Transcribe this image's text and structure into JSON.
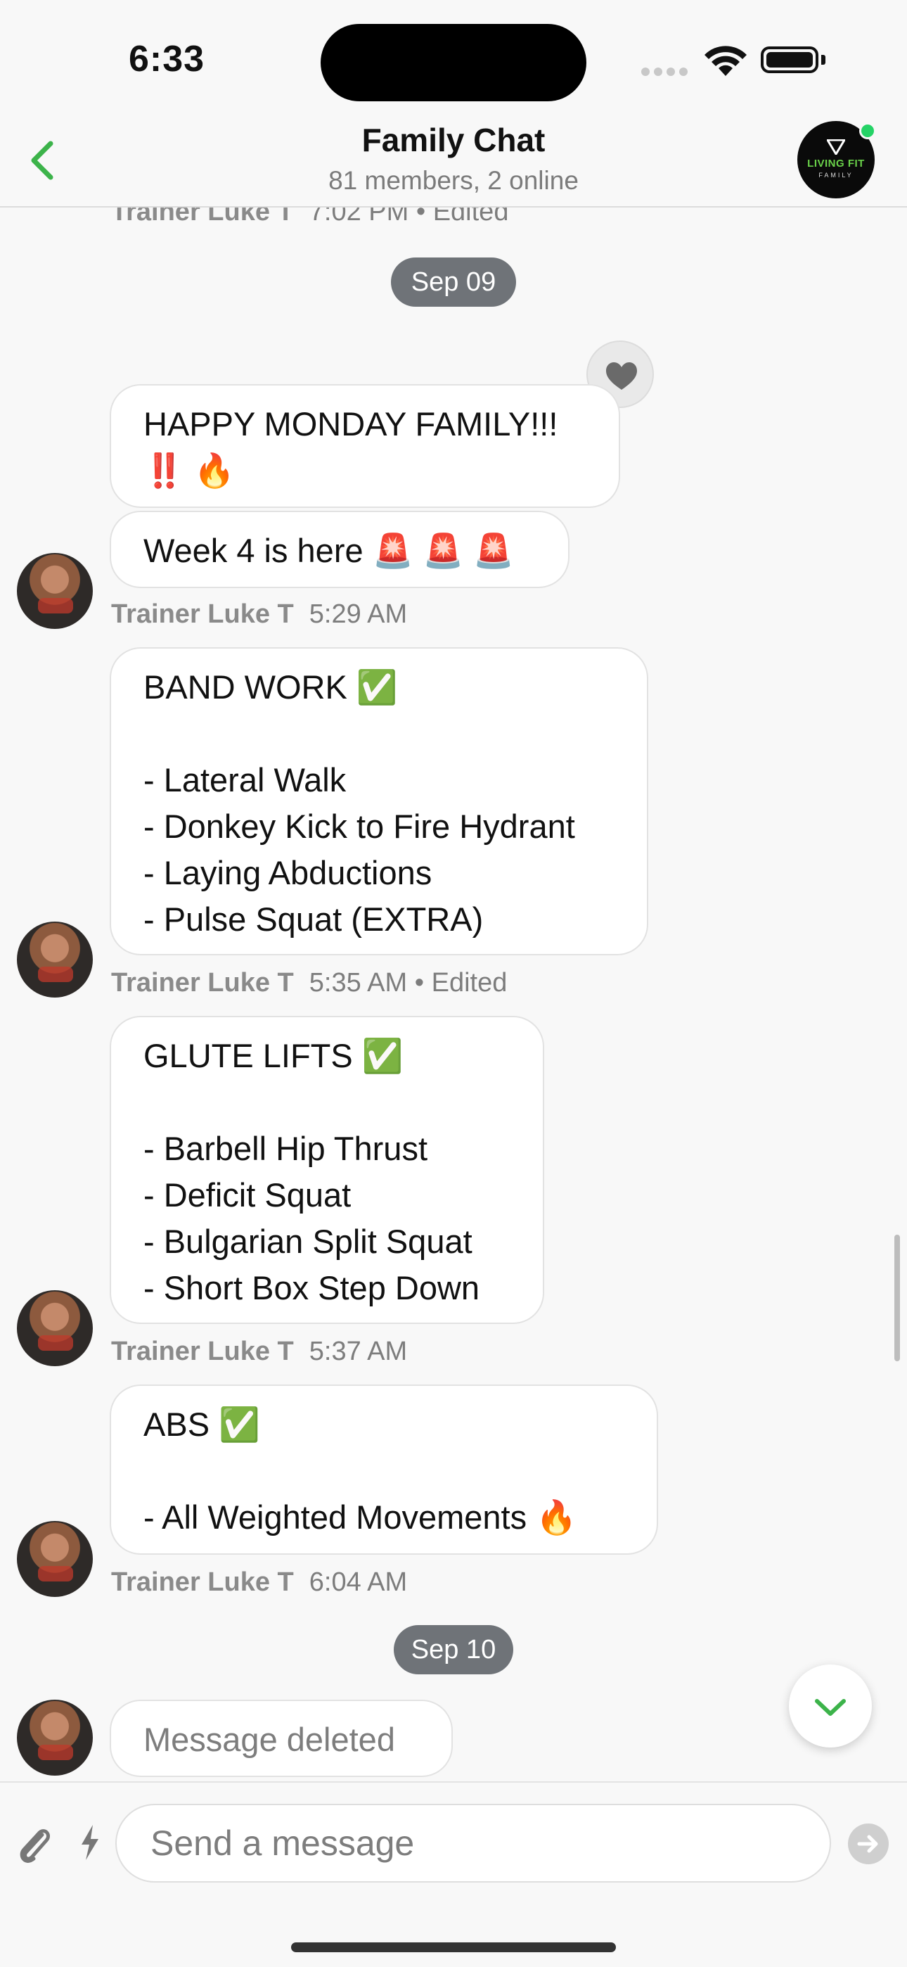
{
  "status_bar": {
    "time": "6:33"
  },
  "header": {
    "title": "Family Chat",
    "subtitle": "81 members, 2 online",
    "group_logo": "LIVING FIT",
    "group_logo_sub": "FAMILY"
  },
  "messages": {
    "top_meta": {
      "name": "Trainer Luke T",
      "time": "7:02 PM",
      "edited": "• Edited"
    },
    "date_1": "Sep 09",
    "m1_text": "HAPPY MONDAY FAMILY!!!\n‼️ 🔥",
    "m2_text": "Week 4 is here 🚨 🚨 🚨",
    "m2_meta": {
      "name": "Trainer Luke T",
      "time": "5:29 AM"
    },
    "m3_text": "BAND WORK ✅\n\n- Lateral Walk\n- Donkey Kick to Fire Hydrant\n- Laying Abductions\n- Pulse Squat (EXTRA)",
    "m3_meta": {
      "name": "Trainer Luke T",
      "time": "5:35 AM",
      "edited": "• Edited"
    },
    "m4_text": "GLUTE LIFTS ✅\n\n- Barbell Hip Thrust\n- Deficit Squat\n- Bulgarian Split Squat\n- Short Box Step Down",
    "m4_meta": {
      "name": "Trainer Luke T",
      "time": "5:37 AM"
    },
    "m5_text": "ABS ✅\n\n- All Weighted Movements 🔥",
    "m5_meta": {
      "name": "Trainer Luke T",
      "time": "6:04 AM"
    },
    "date_2": "Sep 10",
    "m6_text": "Message deleted"
  },
  "composer": {
    "placeholder": "Send a message"
  },
  "colors": {
    "accent": "#3cb34a",
    "date_pill": "#6f7378",
    "online": "#25d366"
  },
  "icons": [
    "back-chevron-icon",
    "heart-icon",
    "chevron-down-icon",
    "paperclip-icon",
    "bolt-icon",
    "send-arrow-icon",
    "wifi-icon",
    "battery-icon"
  ]
}
